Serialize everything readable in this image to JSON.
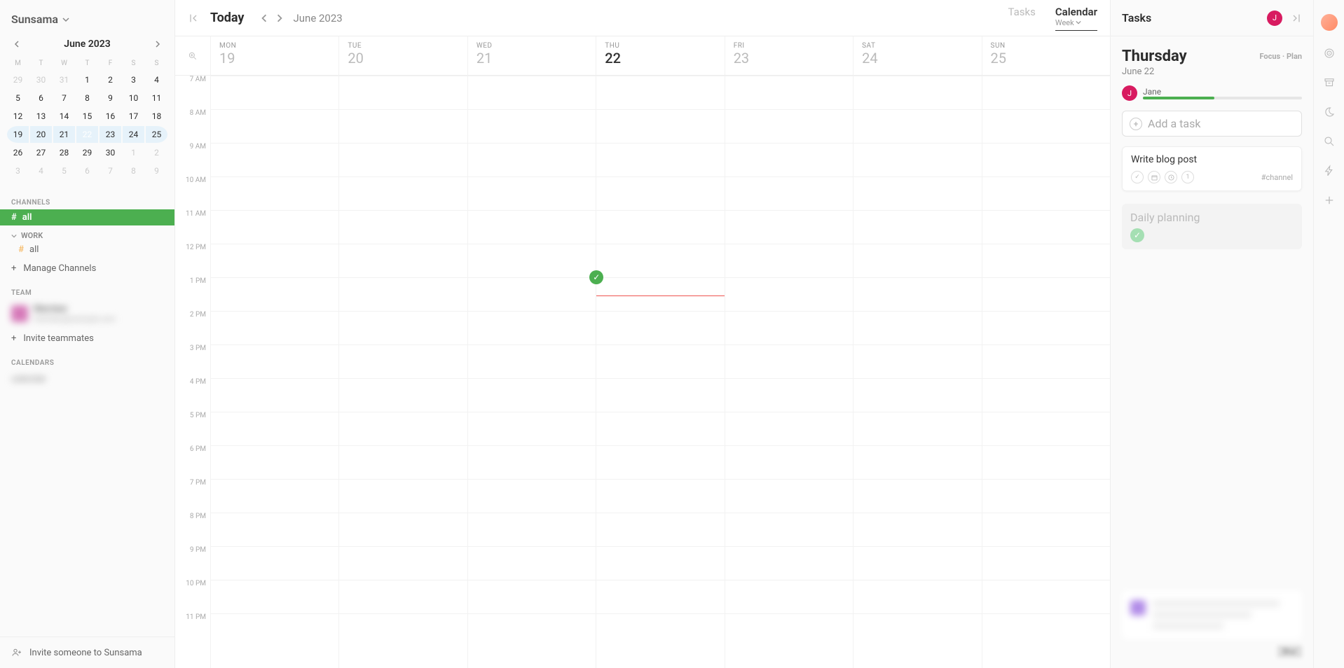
{
  "workspace": {
    "name": "Sunsama"
  },
  "miniCal": {
    "month_label": "June 2023",
    "dows": [
      "M",
      "T",
      "W",
      "T",
      "F",
      "S",
      "S"
    ],
    "days": [
      {
        "n": "29",
        "o": true
      },
      {
        "n": "30",
        "o": true
      },
      {
        "n": "31",
        "o": true
      },
      {
        "n": "1"
      },
      {
        "n": "2"
      },
      {
        "n": "3"
      },
      {
        "n": "4"
      },
      {
        "n": "5"
      },
      {
        "n": "6"
      },
      {
        "n": "7"
      },
      {
        "n": "8"
      },
      {
        "n": "9"
      },
      {
        "n": "10"
      },
      {
        "n": "11"
      },
      {
        "n": "12"
      },
      {
        "n": "13"
      },
      {
        "n": "14"
      },
      {
        "n": "15"
      },
      {
        "n": "16"
      },
      {
        "n": "17"
      },
      {
        "n": "18"
      },
      {
        "n": "19",
        "wr": "first"
      },
      {
        "n": "20",
        "wr": "mid"
      },
      {
        "n": "21",
        "wr": "mid"
      },
      {
        "n": "22",
        "sel": true,
        "wr": "mid"
      },
      {
        "n": "23",
        "wr": "mid"
      },
      {
        "n": "24",
        "wr": "mid"
      },
      {
        "n": "25",
        "wr": "last"
      },
      {
        "n": "26"
      },
      {
        "n": "27"
      },
      {
        "n": "28"
      },
      {
        "n": "29"
      },
      {
        "n": "30"
      },
      {
        "n": "1",
        "o": true
      },
      {
        "n": "2",
        "o": true
      },
      {
        "n": "3",
        "o": true
      },
      {
        "n": "4",
        "o": true
      },
      {
        "n": "5",
        "o": true
      },
      {
        "n": "6",
        "o": true
      },
      {
        "n": "7",
        "o": true
      },
      {
        "n": "8",
        "o": true
      },
      {
        "n": "9",
        "o": true
      }
    ]
  },
  "channels": {
    "label": "CHANNELS",
    "all": "all",
    "work_label": "WORK",
    "sub_all": "all",
    "manage": "Manage Channels"
  },
  "team": {
    "label": "TEAM",
    "invite": "Invite teammates",
    "m_name": "Member",
    "m_email": "member@example.com"
  },
  "cal_section": {
    "label": "CALENDARS",
    "entry": "calendar"
  },
  "invite_bottom": "Invite someone to Sunsama",
  "topbar": {
    "today": "Today",
    "date": "June 2023",
    "tab_tasks": "Tasks",
    "tab_cal": "Calendar",
    "tab_cal_sub": "Week"
  },
  "days": [
    {
      "dow": "MON",
      "num": "19"
    },
    {
      "dow": "TUE",
      "num": "20"
    },
    {
      "dow": "WED",
      "num": "21"
    },
    {
      "dow": "THU",
      "num": "22",
      "today": true
    },
    {
      "dow": "FRI",
      "num": "23"
    },
    {
      "dow": "SAT",
      "num": "24"
    },
    {
      "dow": "SUN",
      "num": "25"
    }
  ],
  "hours": [
    "7 AM",
    "8 AM",
    "9 AM",
    "10 AM",
    "11 AM",
    "12 PM",
    "1 PM",
    "2 PM",
    "3 PM",
    "4 PM",
    "5 PM",
    "6 PM",
    "7 PM",
    "8 PM",
    "9 PM",
    "10 PM",
    "11 PM"
  ],
  "right": {
    "title": "Tasks",
    "avatar_letter": "J",
    "day_name": "Thursday",
    "day_date": "June 22",
    "focus": "Focus",
    "plan": "Plan",
    "user_name": "Jane",
    "add_placeholder": "Add a task",
    "task1": "Write blog post",
    "task1_channel": "#channel",
    "daily": "Daily planning",
    "blur_label": "Blur"
  }
}
